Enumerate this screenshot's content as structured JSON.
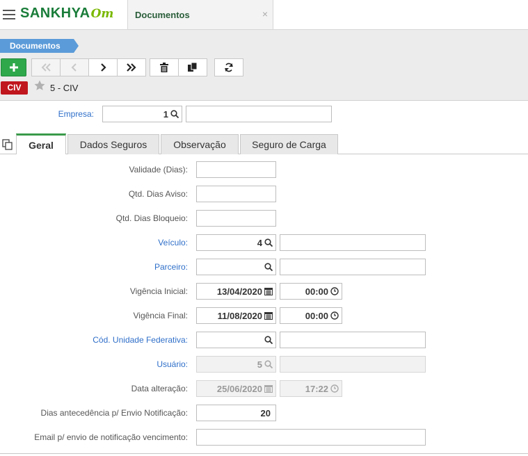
{
  "topbar": {
    "menu_icon": "hamburger-menu-icon",
    "logo": {
      "brand": "SANKHYA",
      "suffix": "Om"
    },
    "tab": {
      "label": "Documentos",
      "close_glyph": "×"
    }
  },
  "toolbar": {
    "breadcrumb": "Documentos",
    "buttons": [
      {
        "name": "add",
        "icon": "plus-icon",
        "enabled": true
      },
      {
        "name": "first",
        "icon": "double-chevron-left-icon",
        "enabled": false
      },
      {
        "name": "previous",
        "icon": "chevron-left-icon",
        "enabled": false
      },
      {
        "name": "next",
        "icon": "chevron-right-icon",
        "enabled": true
      },
      {
        "name": "last",
        "icon": "double-chevron-right-icon",
        "enabled": true
      },
      {
        "name": "delete",
        "icon": "trash-icon",
        "enabled": true
      },
      {
        "name": "duplicate",
        "icon": "copy-icon",
        "enabled": true
      },
      {
        "name": "refresh",
        "icon": "refresh-icon",
        "enabled": true
      }
    ],
    "badge": "CIV",
    "record_title": "5 - CIV"
  },
  "form": {
    "empresa": {
      "label": "Empresa:",
      "value": "1",
      "description": ""
    },
    "tabs": [
      {
        "label": "Geral",
        "active": true
      },
      {
        "label": "Dados Seguros",
        "active": false
      },
      {
        "label": "Observação",
        "active": false
      },
      {
        "label": "Seguro de Carga",
        "active": false
      }
    ],
    "fields": {
      "validade": {
        "label": "Validade (Dias):",
        "value": ""
      },
      "qtd_aviso": {
        "label": "Qtd. Dias Aviso:",
        "value": ""
      },
      "qtd_bloqueio": {
        "label": "Qtd. Dias Bloqueio:",
        "value": ""
      },
      "veiculo": {
        "label": "Veículo:",
        "value": "4",
        "description": ""
      },
      "parceiro": {
        "label": "Parceiro:",
        "value": "",
        "description": ""
      },
      "vig_inicial": {
        "label": "Vigência Inicial:",
        "date": "13/04/2020",
        "time": "00:00"
      },
      "vig_final": {
        "label": "Vigência Final:",
        "date": "11/08/2020",
        "time": "00:00"
      },
      "uf": {
        "label": "Cód. Unidade Federativa:",
        "value": "",
        "description": ""
      },
      "usuario": {
        "label": "Usuário:",
        "value": "5",
        "description": ""
      },
      "data_alteracao": {
        "label": "Data alteração:",
        "date": "25/06/2020",
        "time": "17:22"
      },
      "dias_antecedencia": {
        "label": "Dias antecedência p/ Envio Notificação:",
        "value": "20"
      },
      "email": {
        "label": "Email p/ envio de notificação vencimento:",
        "value": ""
      }
    }
  },
  "colors": {
    "brand_green": "#1a7d3a",
    "accent_green": "#2ea84b",
    "breadcrumb_blue": "#5b9bd9",
    "badge_red": "#c0161d",
    "link_blue": "#2f6fc9"
  }
}
